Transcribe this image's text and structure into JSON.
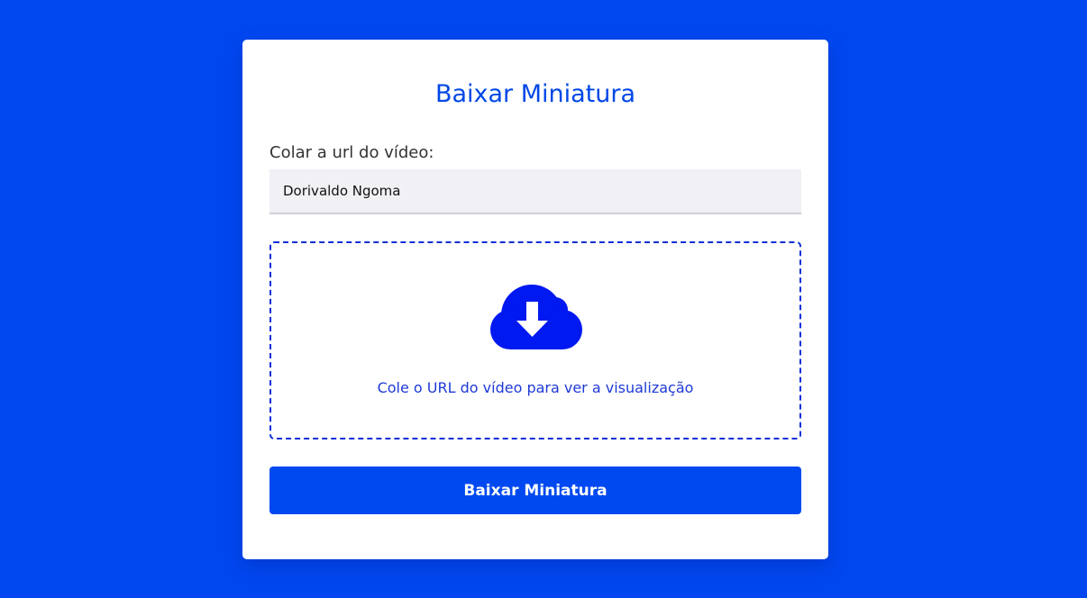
{
  "card": {
    "title": "Baixar Miniatura",
    "url_label": "Colar a url do vídeo:",
    "url_input_value": "Dorivaldo Ngoma",
    "preview": {
      "icon": "cloud-download-icon",
      "text": "Cole o URL do vídeo para ver a visualização"
    },
    "download_button_label": "Baixar Miniatura"
  },
  "colors": {
    "background": "#0047f0",
    "accent": "#0049f0",
    "title": "#0047e6",
    "icon": "#0019f0",
    "dashed_border": "#0b2fd8"
  }
}
